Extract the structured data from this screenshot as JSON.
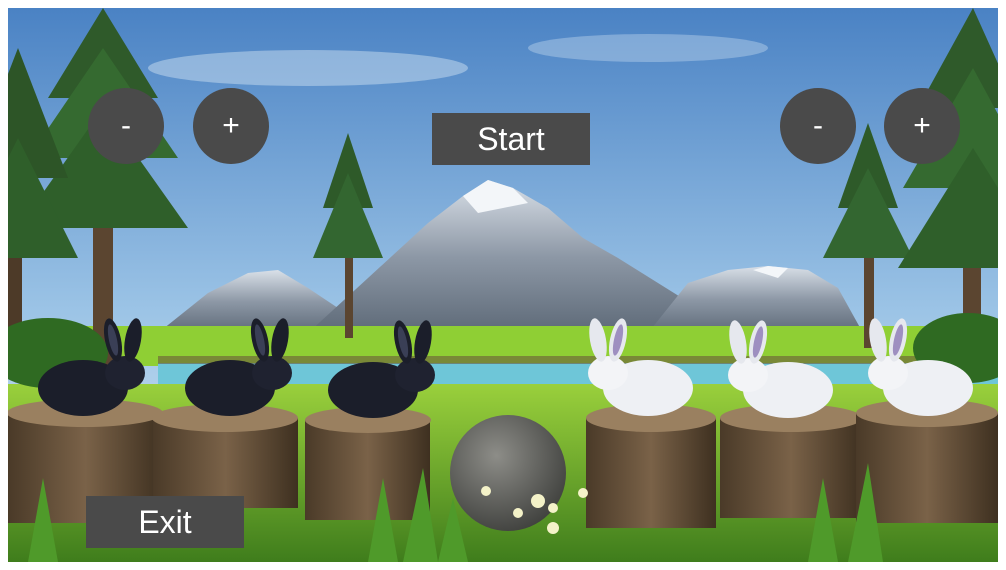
{
  "hud": {
    "start_label": "Start",
    "exit_label": "Exit",
    "left_minus_label": "-",
    "left_plus_label": "+",
    "right_minus_label": "-",
    "right_plus_label": "+"
  },
  "scene": {
    "black_rabbits": 3,
    "white_rabbits": 3,
    "colors": {
      "button_bg": "#4a4a4a",
      "button_text": "#ffffff",
      "sky_top": "#4f86c6",
      "sky_bottom": "#cfe4f4",
      "grass": "#7fbf2e",
      "water": "#6ec6d8"
    }
  }
}
